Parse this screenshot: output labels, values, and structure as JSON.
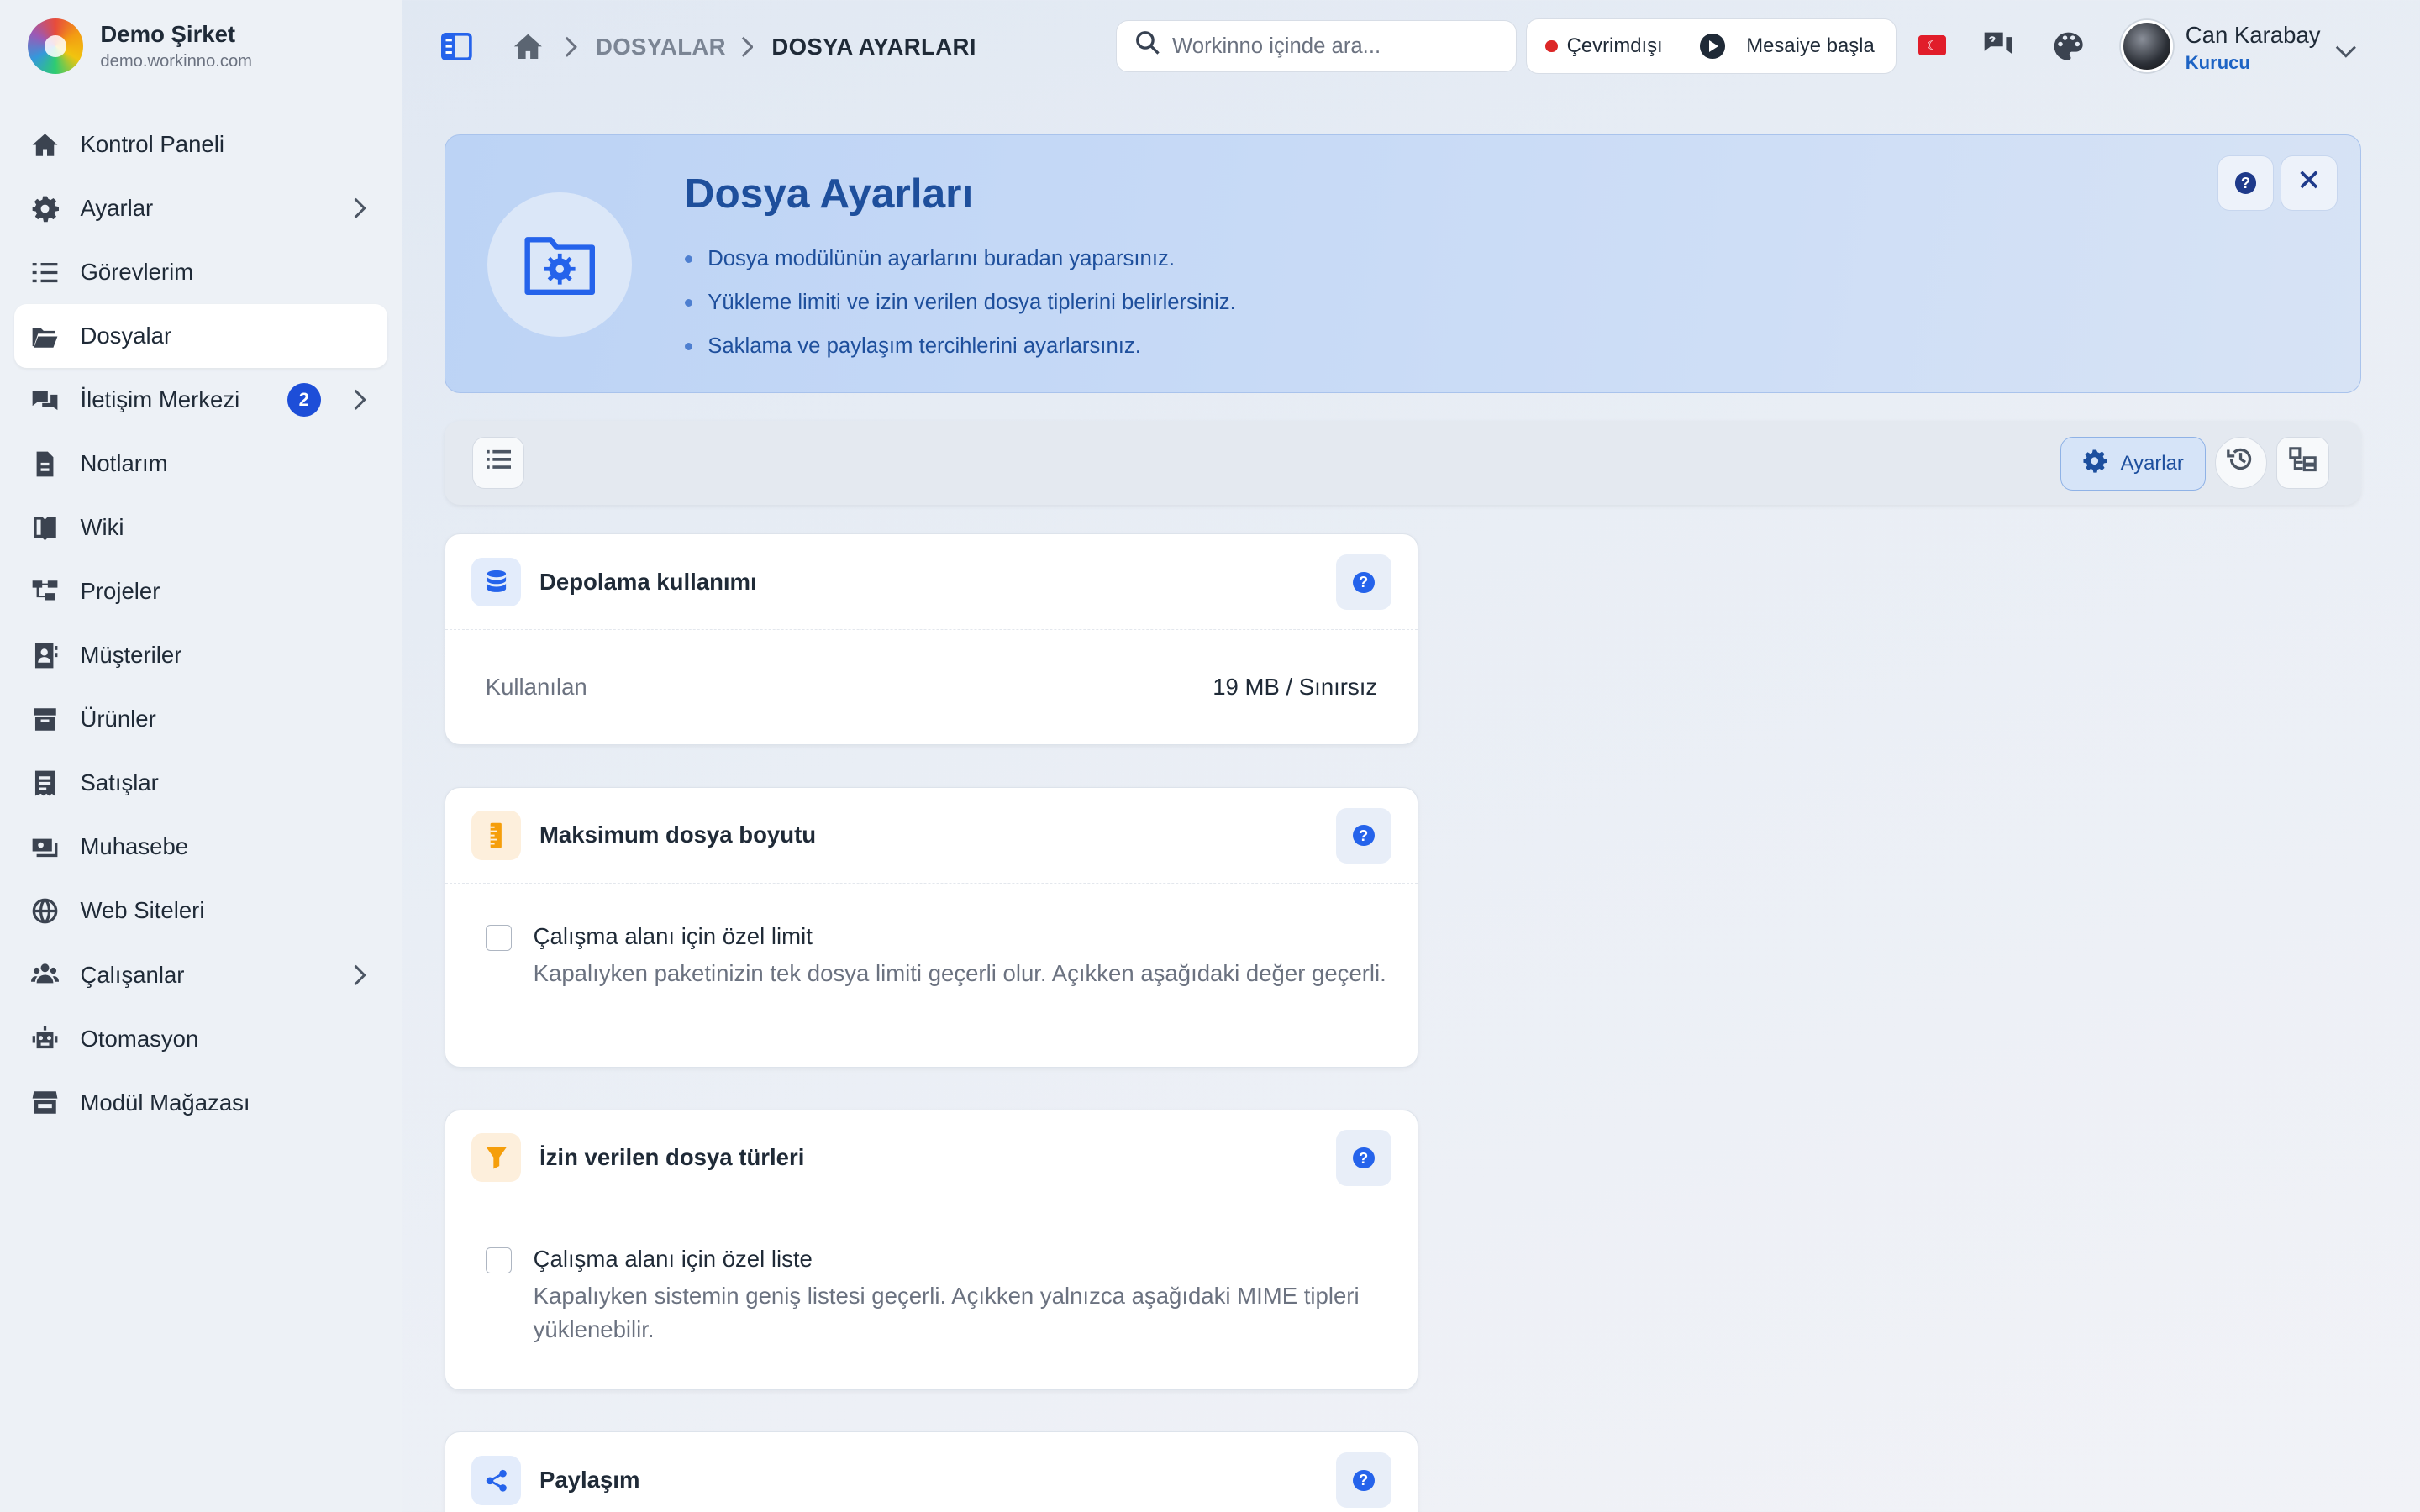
{
  "brand": {
    "name": "Demo Şirket",
    "domain": "demo.workinno.com"
  },
  "sidebar": {
    "items": [
      {
        "label": "Kontrol Paneli",
        "icon": "home-icon"
      },
      {
        "label": "Ayarlar",
        "icon": "gear-icon",
        "has_submenu": true
      },
      {
        "label": "Görevlerim",
        "icon": "tasks-icon"
      },
      {
        "label": "Dosyalar",
        "icon": "folder-open-icon",
        "active": true
      },
      {
        "label": "İletişim Merkezi",
        "icon": "chat-icon",
        "badge": "2",
        "has_submenu": true
      },
      {
        "label": "Notlarım",
        "icon": "note-icon"
      },
      {
        "label": "Wiki",
        "icon": "book-icon"
      },
      {
        "label": "Projeler",
        "icon": "project-icon"
      },
      {
        "label": "Müşteriler",
        "icon": "contact-icon"
      },
      {
        "label": "Ürünler",
        "icon": "box-icon"
      },
      {
        "label": "Satışlar",
        "icon": "receipt-icon"
      },
      {
        "label": "Muhasebe",
        "icon": "money-icon"
      },
      {
        "label": "Web Siteleri",
        "icon": "globe-icon"
      },
      {
        "label": "Çalışanlar",
        "icon": "users-icon",
        "has_submenu": true
      },
      {
        "label": "Otomasyon",
        "icon": "robot-icon"
      },
      {
        "label": "Modül Mağazası",
        "icon": "store-icon"
      }
    ]
  },
  "header": {
    "breadcrumb": [
      "DOSYALAR",
      "DOSYA AYARLARI"
    ],
    "search_placeholder": "Workinno içinde ara...",
    "status": "Çevrimdışı",
    "shift_button": "Mesaiye başla",
    "user": {
      "name": "Can Karabay",
      "role": "Kurucu"
    }
  },
  "hero": {
    "title": "Dosya Ayarları",
    "bullets": [
      "Dosya modülünün ayarlarını buradan yaparsınız.",
      "Yükleme limiti ve izin verilen dosya tiplerini belirlersiniz.",
      "Saklama ve paylaşım tercihlerini ayarlarsınız."
    ]
  },
  "toolbar": {
    "settings_label": "Ayarlar"
  },
  "cards": {
    "storage": {
      "title": "Depolama kullanımı",
      "label": "Kullanılan",
      "value": "19 MB / Sınırsız"
    },
    "max_size": {
      "title": "Maksimum dosya boyutu",
      "option_title": "Çalışma alanı için özel limit",
      "option_desc": "Kapalıyken paketinizin tek dosya limiti geçerli olur. Açıkken aşağıdaki değer geçerli.",
      "checked": false
    },
    "file_types": {
      "title": "İzin verilen dosya türleri",
      "option_title": "Çalışma alanı için özel liste",
      "option_desc": "Kapalıyken sistemin geniş listesi geçerli. Açıkken yalnızca aşağıdaki MIME tipleri yüklenebilir.",
      "checked": false
    },
    "sharing": {
      "title": "Paylaşım"
    }
  },
  "colors": {
    "accent": "#1d4ed8",
    "hero_bg": "#c9dbf6",
    "hero_text": "#1e4f9c",
    "status_offline": "#dc2626"
  }
}
